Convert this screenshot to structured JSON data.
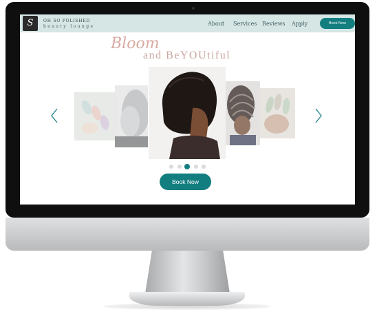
{
  "brand": {
    "logo_letter": "S",
    "name_line1": "OH SO POLISHED",
    "name_line2": "beauty lounge"
  },
  "nav": {
    "items": [
      {
        "label": "About"
      },
      {
        "label": "Services"
      },
      {
        "label": "Reviews"
      },
      {
        "label": "Apply"
      }
    ],
    "book_button": "Book Now"
  },
  "hero": {
    "script_word": "Bloom",
    "tagline": "and BeYOUtiful",
    "cta_label": "Book Now"
  },
  "carousel": {
    "slides": [
      {
        "subject": "nail art"
      },
      {
        "subject": "silver hair"
      },
      {
        "subject": "bob haircut"
      },
      {
        "subject": "braided hairstyle"
      },
      {
        "subject": "nail design"
      }
    ],
    "dots_total": 5,
    "active_index": 3,
    "prev_icon": "chevron-left-icon",
    "next_icon": "chevron-right-icon"
  },
  "colors": {
    "accent": "#137e80",
    "header_bg": "#d6e6e5",
    "script_pink": "#d8a9a1"
  }
}
